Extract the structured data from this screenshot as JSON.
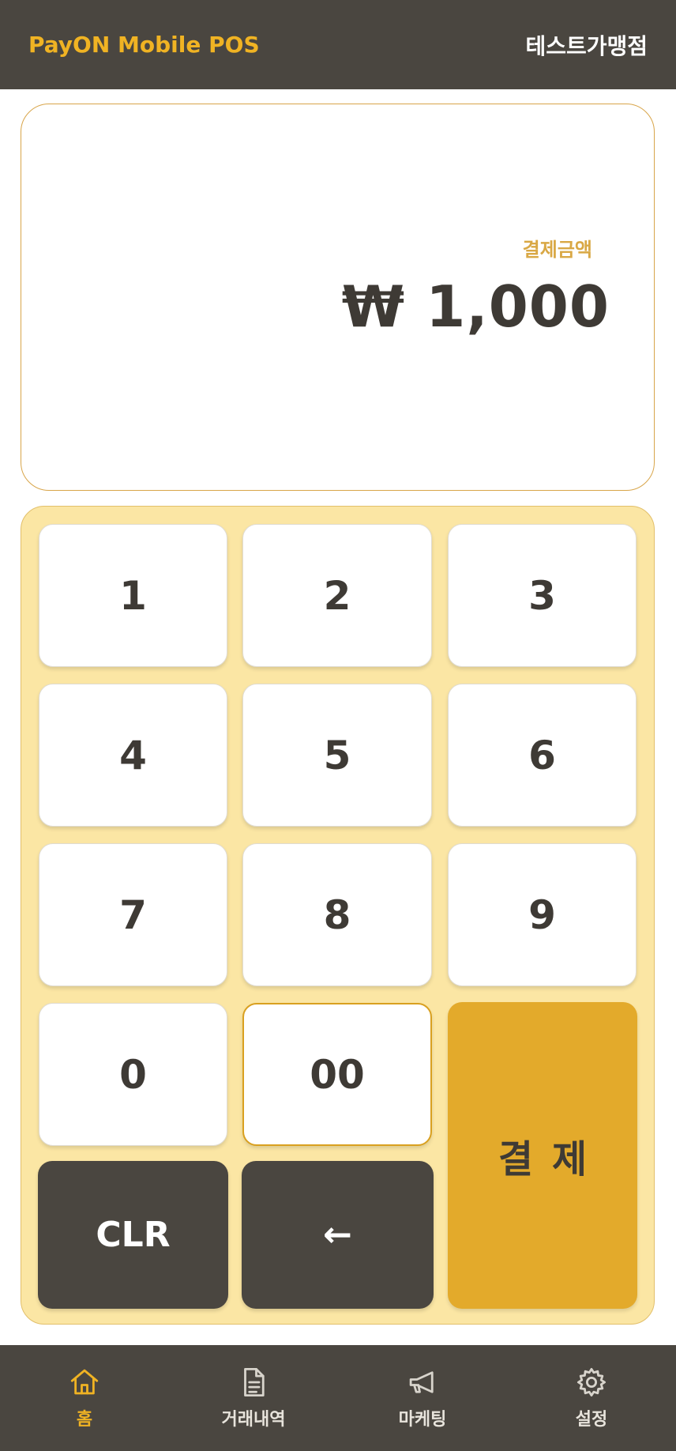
{
  "header": {
    "brand": "PayON Mobile POS",
    "store": "테스트가맹점"
  },
  "amount": {
    "label": "결제금액",
    "value": "₩ 1,000"
  },
  "keypad": {
    "k1": "1",
    "k2": "2",
    "k3": "3",
    "k4": "4",
    "k5": "5",
    "k6": "6",
    "k7": "7",
    "k8": "8",
    "k9": "9",
    "k0": "0",
    "k00": "00",
    "clear": "CLR",
    "backspace": "←",
    "pay": "결제"
  },
  "tabs": [
    {
      "label": "홈",
      "icon": "home-icon"
    },
    {
      "label": "거래내역",
      "icon": "document-icon"
    },
    {
      "label": "마케팅",
      "icon": "megaphone-icon"
    },
    {
      "label": "설정",
      "icon": "gear-icon"
    }
  ],
  "colors": {
    "accent": "#f0b323",
    "dark": "#4a4640",
    "keypad_bg": "#fbe6a4",
    "pay": "#e3aa2b"
  }
}
